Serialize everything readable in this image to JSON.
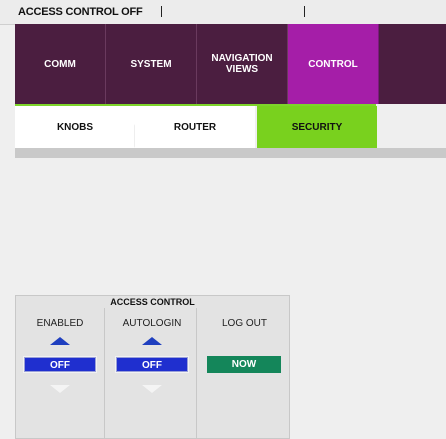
{
  "status": {
    "text": "ACCESS CONTROL OFF"
  },
  "main_tabs": [
    {
      "label": "COMM",
      "active": false
    },
    {
      "label": "SYSTEM",
      "active": false
    },
    {
      "label": "NAVIGATION VIEWS",
      "active": false
    },
    {
      "label": "CONTROL",
      "active": true
    }
  ],
  "sub_tabs": [
    {
      "label": "KNOBS",
      "active": false
    },
    {
      "label": "ROUTER",
      "active": false
    },
    {
      "label": "SECURITY",
      "active": true
    }
  ],
  "panel": {
    "title": "ACCESS CONTROL",
    "columns": [
      {
        "label": "ENABLED",
        "value": "OFF"
      },
      {
        "label": "AUTOLOGIN",
        "value": "OFF"
      },
      {
        "label": "LOG OUT",
        "value": "NOW"
      }
    ]
  },
  "colors": {
    "main_nav_bg": "#4b1e40",
    "main_nav_active": "#a51ea8",
    "sub_nav_active": "#79d11e",
    "off_button": "#1f2fcf",
    "now_button": "#14865a"
  }
}
